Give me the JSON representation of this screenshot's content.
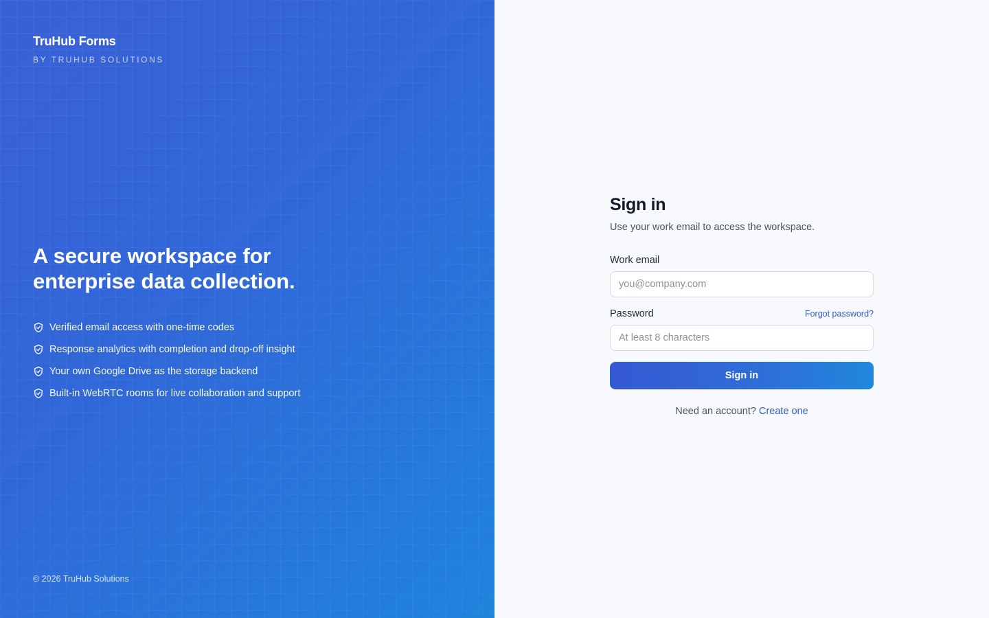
{
  "brand": {
    "name": "TruHub Forms",
    "tagline": "BY TRUHUB SOLUTIONS"
  },
  "hero": {
    "title_line1": "A secure workspace for",
    "title_line2": "enterprise data collection."
  },
  "features": [
    {
      "icon": "shield-check-icon",
      "label": "Verified email access with one-time codes"
    },
    {
      "icon": "shield-check-icon",
      "label": "Response analytics with completion and drop-off insight"
    },
    {
      "icon": "shield-check-icon",
      "label": "Your own Google Drive as the storage backend"
    },
    {
      "icon": "shield-check-icon",
      "label": "Built-in WebRTC rooms for live collaboration and support"
    }
  ],
  "footer": {
    "copyright": "© 2026 TruHub Solutions"
  },
  "signin": {
    "title": "Sign in",
    "subtitle": "Use your work email to access the workspace.",
    "email": {
      "label": "Work email",
      "value": "",
      "placeholder": "you@company.com"
    },
    "password": {
      "label": "Password",
      "value": "",
      "placeholder": "At least 8 characters",
      "forgot_label": "Forgot password?"
    },
    "submit_label": "Sign in",
    "signup_prompt": "Need an account?",
    "signup_link": "Create one"
  },
  "colors": {
    "gradient_start": "#3a60d6",
    "gradient_end": "#1f84dc",
    "accent_link": "#2f5ad1",
    "panel_background": "#f7f9fc"
  }
}
